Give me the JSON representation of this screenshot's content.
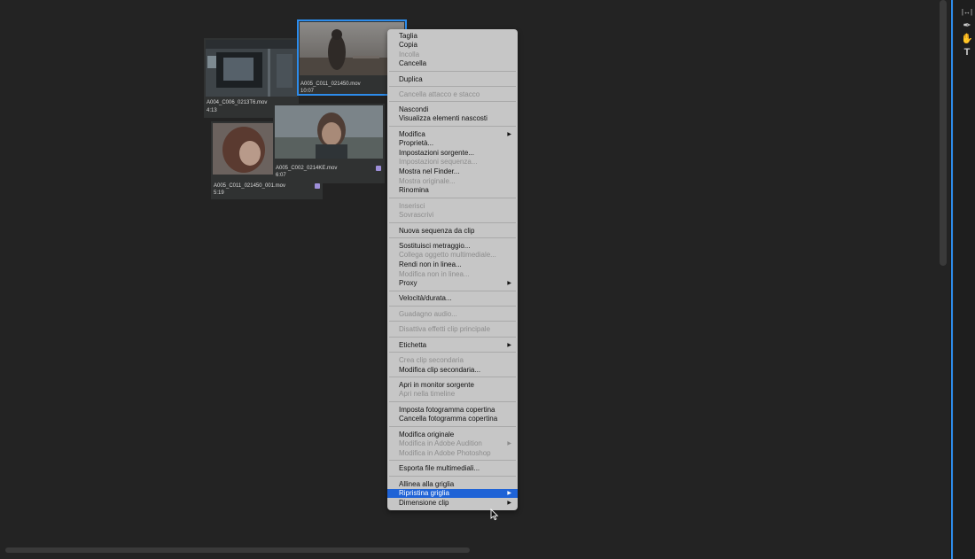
{
  "clips": [
    {
      "name": "A004_C006_0213T6.mov",
      "duration": "4:13"
    },
    {
      "name": "A005_C011_021450.mov",
      "duration": "10:07"
    },
    {
      "name": "A005_C002_0214KE.mov",
      "duration": "6:07"
    },
    {
      "name": "A005_C011_021450_001.mov",
      "duration": "5:19"
    }
  ],
  "menu": {
    "items": [
      {
        "label": "Taglia",
        "enabled": true
      },
      {
        "label": "Copia",
        "enabled": true
      },
      {
        "label": "Incolla",
        "enabled": false
      },
      {
        "label": "Cancella",
        "enabled": true
      },
      {
        "label": "Duplica",
        "enabled": true
      },
      {
        "label": "Cancella attacco e stacco",
        "enabled": false
      },
      {
        "label": "Nascondi",
        "enabled": true
      },
      {
        "label": "Visualizza elementi nascosti",
        "enabled": true
      },
      {
        "label": "Modifica",
        "enabled": true,
        "submenu": true
      },
      {
        "label": "Proprietà...",
        "enabled": true
      },
      {
        "label": "Impostazioni sorgente...",
        "enabled": true
      },
      {
        "label": "Impostazioni sequenza...",
        "enabled": false
      },
      {
        "label": "Mostra nel Finder...",
        "enabled": true
      },
      {
        "label": "Mostra originale...",
        "enabled": false
      },
      {
        "label": "Rinomina",
        "enabled": true
      },
      {
        "label": "Inserisci",
        "enabled": false
      },
      {
        "label": "Sovrascrivi",
        "enabled": false
      },
      {
        "label": "Nuova sequenza da clip",
        "enabled": true
      },
      {
        "label": "Sostituisci metraggio...",
        "enabled": true
      },
      {
        "label": "Collega oggetto multimediale...",
        "enabled": false
      },
      {
        "label": "Rendi non in linea...",
        "enabled": true
      },
      {
        "label": "Modifica non in linea...",
        "enabled": false
      },
      {
        "label": "Proxy",
        "enabled": true,
        "submenu": true
      },
      {
        "label": "Velocità/durata...",
        "enabled": true
      },
      {
        "label": "Guadagno audio...",
        "enabled": false
      },
      {
        "label": "Disattiva effetti clip principale",
        "enabled": false
      },
      {
        "label": "Etichetta",
        "enabled": true,
        "submenu": true
      },
      {
        "label": "Crea clip secondaria",
        "enabled": false
      },
      {
        "label": "Modifica clip secondaria...",
        "enabled": true
      },
      {
        "label": "Apri in monitor sorgente",
        "enabled": true
      },
      {
        "label": "Apri nella timeline",
        "enabled": false
      },
      {
        "label": "Imposta fotogramma copertina",
        "enabled": true
      },
      {
        "label": "Cancella fotogramma copertina",
        "enabled": true
      },
      {
        "label": "Modifica originale",
        "enabled": true
      },
      {
        "label": "Modifica in Adobe Audition",
        "enabled": false,
        "submenu": true
      },
      {
        "label": "Modifica in Adobe Photoshop",
        "enabled": false
      },
      {
        "label": "Esporta file multimediali...",
        "enabled": true
      },
      {
        "label": "Allinea alla griglia",
        "enabled": true
      },
      {
        "label": "Ripristina griglia",
        "enabled": true,
        "submenu": true,
        "highlighted": true
      },
      {
        "label": "Dimensione clip",
        "enabled": true,
        "submenu": true
      }
    ]
  },
  "tools": [
    {
      "icon": "slip-tool-icon",
      "glyph": "|↔|"
    },
    {
      "icon": "pen-tool-icon",
      "glyph": "✒"
    },
    {
      "icon": "hand-tool-icon",
      "glyph": "✋"
    },
    {
      "icon": "type-tool-icon",
      "glyph": "T"
    }
  ],
  "colors": {
    "highlight": "#1f63d6",
    "selection": "#2d8ceb",
    "label_badge": "#9e8fd9"
  }
}
